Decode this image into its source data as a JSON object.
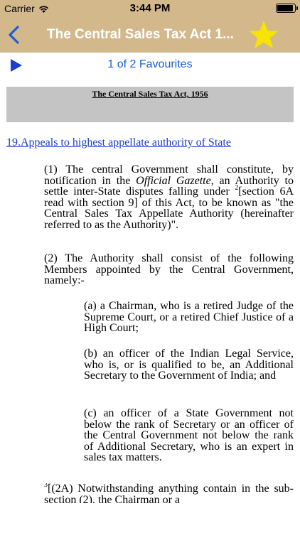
{
  "status_bar": {
    "carrier": "Carrier",
    "time": "3:44 PM"
  },
  "nav": {
    "title": "The Central Sales Tax Act 1...",
    "accent_color": "#d3b88c",
    "back_icon": "chevron-left-icon",
    "favourite_icon": "star-icon",
    "favourite_color": "#f7e400"
  },
  "favourites": {
    "label": "1 of 2 Favourites",
    "play_icon": "play-icon"
  },
  "document": {
    "act_title": "The Central Sales Tax Act, 1956",
    "section_link": "19.Appeals to highest appellate authority of State",
    "p1": {
      "prefix": "(1) The central Government shall constitute, by notification in the ",
      "emphasis": "Official Gazette",
      "middle": ", an Authority to settle inter-State disputes falling under ",
      "sup": "2",
      "suffix": "[section 6A read with section 9] of this Act, to be known as \"the Central Sales Tax Appellate Authority (hereinafter referred to as the Authority)\"."
    },
    "p2": "(2) The Authority shall consist of the following Members appointed by the Central Government, namely:-",
    "p2a": "(a) a Chairman, who is a retired Judge of the Supreme Court, or a retired Chief Justice of a High Court;",
    "p2b": "(b) an officer of the Indian Legal Service, who is, or is qualified to be, an Additional Secretary to the Government of India; and",
    "p2c": "(c) an officer of a State Government not below the rank of Secretary or an officer of the Central Government not below the rank of Additional Secretary, who is an expert in sales tax matters.",
    "p3": {
      "sup": "3",
      "text": "[(2A) Notwithstanding anything contain in the sub-section (2), the Chairman or a"
    }
  }
}
